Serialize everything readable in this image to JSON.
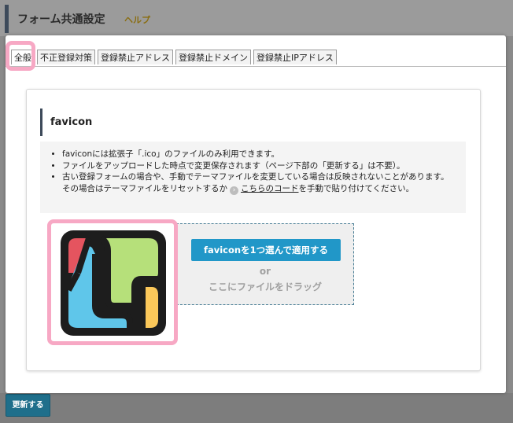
{
  "header": {
    "title": "フォーム共通設定",
    "help_label": "ヘルプ"
  },
  "tabs": [
    {
      "label": "全般",
      "active": true
    },
    {
      "label": "不正登録対策",
      "active": false
    },
    {
      "label": "登録禁止アドレス",
      "active": false
    },
    {
      "label": "登録禁止ドメイン",
      "active": false
    },
    {
      "label": "登録禁止IPアドレス",
      "active": false
    }
  ],
  "favicon": {
    "title": "favicon",
    "info": [
      "faviconには拡張子「.ico」のファイルのみ利用できます。",
      "ファイルをアップロードした時点で変更保存されます（ページ下部の「更新する」は不要）。",
      "古い登録フォームの場合や、手動でテーマファイルを変更している場合は反映されないことがあります。"
    ],
    "info_cont_prefix": "その場合はテーマファイルをリセットするか",
    "info_link_arrow": "›",
    "info_link": "こちらのコード",
    "info_cont_suffix": "を手動で貼り付けてください。",
    "choose_button": "faviconを1つ選んで適用する",
    "or": "or",
    "drag_text": "ここにファイルをドラッグ"
  },
  "footer": {
    "update_button": "更新する"
  },
  "colors": {
    "accent": "#3d4a5a",
    "primary_button": "#2197c8",
    "highlight": "#f7a8c4",
    "update_button": "#1f6f8b"
  }
}
